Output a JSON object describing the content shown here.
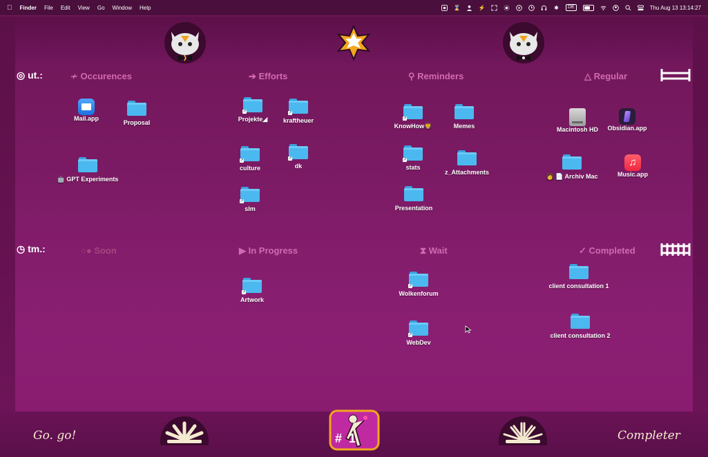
{
  "menubar": {
    "app_name": "Finder",
    "menus": [
      "File",
      "Edit",
      "View",
      "Go",
      "Window",
      "Help"
    ],
    "input_language": "DE",
    "clock": "Thu Aug 13  13:14:27"
  },
  "rows": {
    "top": {
      "label": "ut.:"
    },
    "bottom": {
      "label": "tm.:"
    }
  },
  "sections": {
    "occurences": "≁ Occurences",
    "efforts": "➔ Efforts",
    "reminders": "⚲ Reminders",
    "regular": "△ Regular",
    "soon": "○● Soon",
    "in_progress": "▶ In Progress",
    "wait": "⧗ Wait",
    "completed": "✓ Completed"
  },
  "desktop_items": {
    "mail": "Mail.app",
    "proposal": "Proposal",
    "gpt": "🤖 GPT Experiments",
    "projekte": "Projekte◢",
    "kraftheuer": "kraftheuer",
    "culture": "culture",
    "dk": "dk",
    "slm": "slm",
    "knowhow": "KnowHow🦁",
    "memes": "Memes",
    "stats": "stats",
    "z_attachments": "z_Attachments",
    "presentation": "Presentation",
    "macintosh_hd": "Macintosh HD",
    "obsidian": "Obsidian.app",
    "archiv_mac": "👩 📄 Archiv Mac",
    "music": "Music.app",
    "artwork": "Artwork",
    "wolkenforum": "Wolkenforum",
    "webdev": "WebDev",
    "client1": "client consultation 1",
    "client2": "client consultation 2"
  },
  "footer": {
    "left_script": "Go. go!",
    "right_script": "Completer",
    "badge_text": "#  1"
  },
  "colors": {
    "background": "#7a1a63",
    "section_label": "#d16ab2",
    "folder_blue": "#4bb8f0"
  }
}
